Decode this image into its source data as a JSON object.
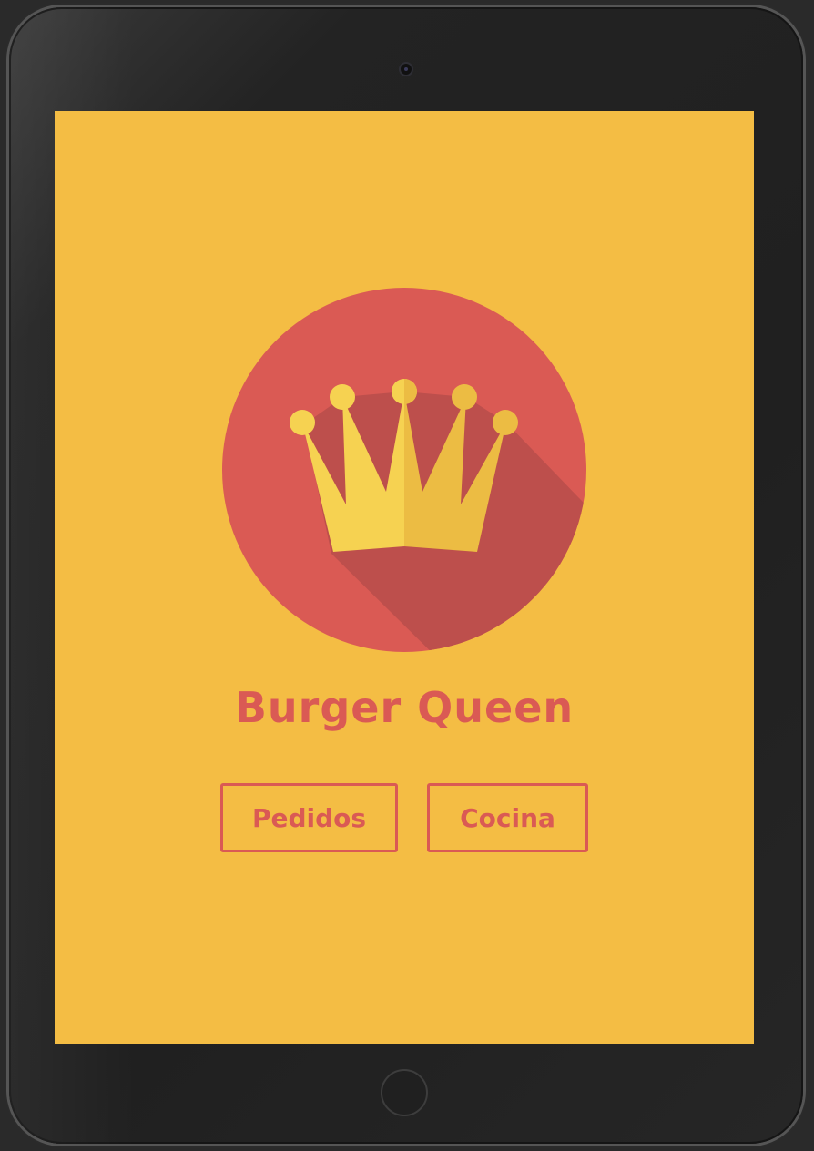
{
  "app": {
    "title": "Burger Queen"
  },
  "logo": {
    "icon": "crown-icon",
    "colors": {
      "circle": "#da5a54",
      "shadow": "#bd4f4c",
      "crown_light": "#f6d251",
      "crown_dark": "#ecbc43"
    }
  },
  "buttons": {
    "pedidos_label": "Pedidos",
    "cocina_label": "Cocina"
  },
  "theme": {
    "background": "#f4bd44",
    "accent": "#da5a54"
  }
}
